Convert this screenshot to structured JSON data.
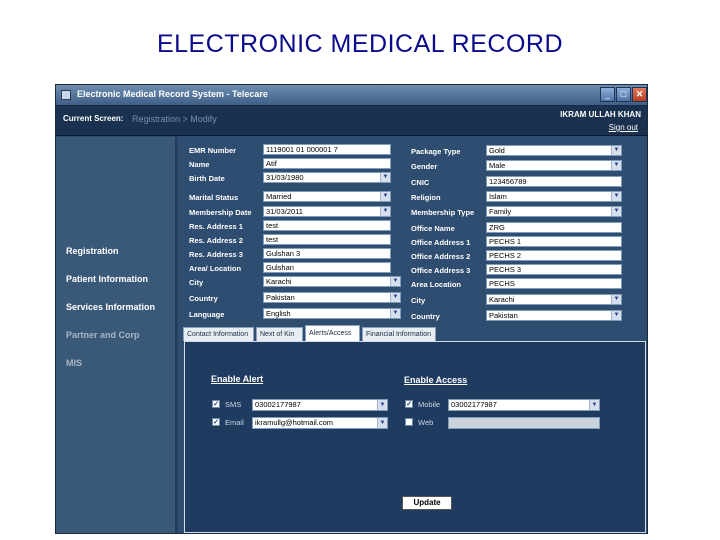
{
  "slide": {
    "title": "ELECTRONIC MEDICAL RECORD"
  },
  "window": {
    "title": "Electronic Medical Record System - Telecare"
  },
  "header": {
    "current_screen_label": "Current Screen:",
    "current_screen_value": "Registration > Modify",
    "user_name": "IKRAM ULLAH KHAN",
    "signout_label": "Sign out"
  },
  "sidebar": {
    "items": [
      {
        "label": "Registration"
      },
      {
        "label": "Patient Information"
      },
      {
        "label": "Services Information"
      },
      {
        "label": "Partner and Corp"
      },
      {
        "label": "MIS"
      }
    ]
  },
  "form": {
    "left": [
      {
        "label": "EMR Number",
        "value": "1119001 01 000001 7"
      },
      {
        "label": "Name",
        "value": "Atif"
      },
      {
        "label": "Birth Date",
        "value": "31/03/1980"
      },
      {
        "label": "Marital Status",
        "value": "Married"
      },
      {
        "label": "Membership Date",
        "value": "31/03/2011"
      },
      {
        "label": "Res. Address 1",
        "value": "test"
      },
      {
        "label": "Res. Address 2",
        "value": "test"
      },
      {
        "label": "Res. Address 3",
        "value": "Gulshan 3"
      },
      {
        "label": "Area/ Location",
        "value": "Gulshan"
      },
      {
        "label": "City",
        "value": "Karachi"
      },
      {
        "label": "Country",
        "value": "Pakistan"
      },
      {
        "label": "Language",
        "value": "English"
      }
    ],
    "right": [
      {
        "label": "Package Type",
        "value": "Gold"
      },
      {
        "label": "Gender",
        "value": "Male"
      },
      {
        "label": "CNIC",
        "value": "123456789"
      },
      {
        "label": "Religion",
        "value": "Islam"
      },
      {
        "label": "Membership Type",
        "value": "Family"
      },
      {
        "label": "Office Name",
        "value": "ZRG"
      },
      {
        "label": "Office Address 1",
        "value": "PECHS 1"
      },
      {
        "label": "Office Address 2",
        "value": "PECHS 2"
      },
      {
        "label": "Office Address 3",
        "value": "PECHS 3"
      },
      {
        "label": "Area Location",
        "value": "PECHS"
      },
      {
        "label": "City",
        "value": "Karachi"
      },
      {
        "label": "Country",
        "value": "Pakistan"
      }
    ]
  },
  "tabs": [
    {
      "label": "Contact Information"
    },
    {
      "label": "Next of Kin"
    },
    {
      "label": "Alerts/Access"
    },
    {
      "label": "Financial Information"
    }
  ],
  "alerts": {
    "enable_alert_title": "Enable Alert",
    "sms_label": "SMS",
    "sms_value": "03002177987",
    "email_label": "Email",
    "email_value": "ikramullg@hotmail.com",
    "enable_access_title": "Enable Access",
    "mobile_label": "Mobile",
    "mobile_value": "03002177987",
    "web_label": "Web",
    "web_value": ""
  },
  "buttons": {
    "update": "Update"
  },
  "glyphs": {
    "check": "✓",
    "arrow": "▼",
    "minimize": "_",
    "maximize": "□",
    "close": "✕"
  }
}
